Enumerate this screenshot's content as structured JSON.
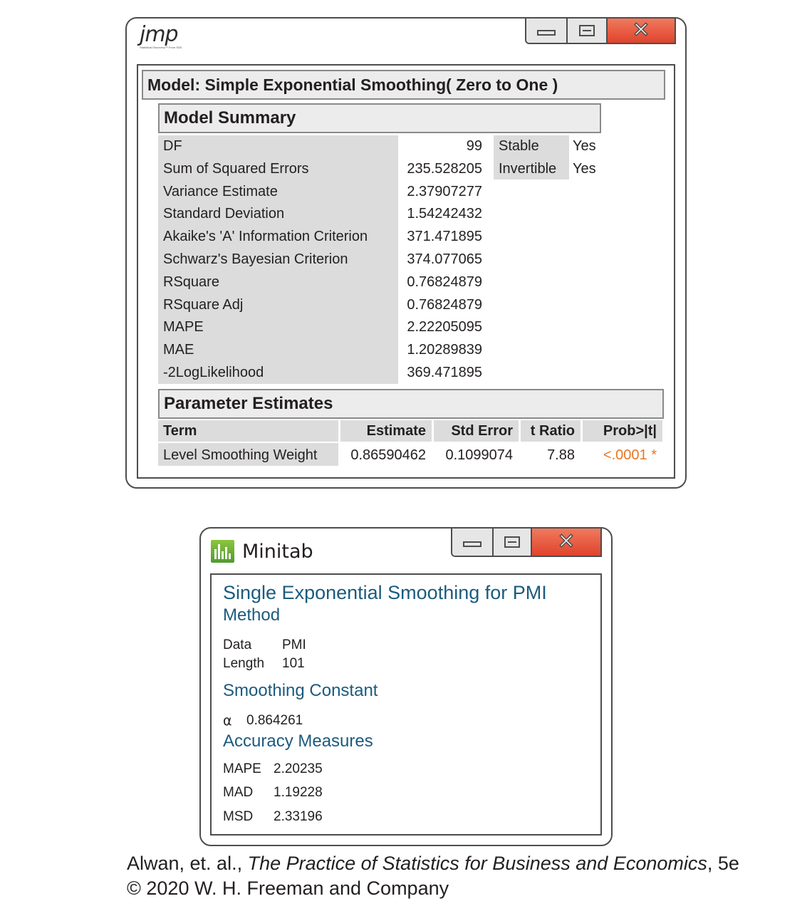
{
  "jmp": {
    "logo_text": "jmp",
    "logo_tagline": "Statistical Discovery™ From SAS",
    "window_title": "Model: Simple Exponential Smoothing( Zero to One )",
    "model_summary": {
      "heading": "Model Summary",
      "rows": [
        {
          "label": "DF",
          "value": "99"
        },
        {
          "label": "Sum of Squared Errors",
          "value": "235.528205"
        },
        {
          "label": "Variance Estimate",
          "value": "2.37907277"
        },
        {
          "label": "Standard Deviation",
          "value": "1.54242432"
        },
        {
          "label": "Akaike's 'A' Information Criterion",
          "value": "371.471895"
        },
        {
          "label": "Schwarz's Bayesian Criterion",
          "value": "374.077065"
        },
        {
          "label": "RSquare",
          "value": "0.76824879"
        },
        {
          "label": "RSquare Adj",
          "value": "0.76824879"
        },
        {
          "label": "MAPE",
          "value": "2.22205095"
        },
        {
          "label": "MAE",
          "value": "1.20289839"
        },
        {
          "label": "-2LogLikelihood",
          "value": "369.471895"
        }
      ],
      "side": [
        {
          "label": "Stable",
          "value": "Yes"
        },
        {
          "label": "Invertible",
          "value": "Yes"
        }
      ]
    },
    "parameter_estimates": {
      "heading": "Parameter Estimates",
      "columns": [
        "Term",
        "Estimate",
        "Std Error",
        "t Ratio",
        "Prob>|t|"
      ],
      "row": {
        "term": "Level Smoothing Weight",
        "estimate": "0.86590462",
        "std_error": "0.1099074",
        "t_ratio": "7.88",
        "prob": "<.0001 *"
      }
    }
  },
  "minitab": {
    "app_name": "Minitab",
    "title": "Single Exponential Smoothing for PMI",
    "method_heading": "Method",
    "method": [
      {
        "label": "Data",
        "value": "PMI"
      },
      {
        "label": "Length",
        "value": "101"
      }
    ],
    "smoothing_heading": "Smoothing Constant",
    "alpha_label": "α",
    "alpha_value": "0.864261",
    "accuracy_heading": "Accuracy Measures",
    "accuracy": [
      {
        "label": "MAPE",
        "value": "2.20235"
      },
      {
        "label": "MAD",
        "value": "1.19228"
      },
      {
        "label": "MSD",
        "value": "2.33196"
      }
    ]
  },
  "footer": {
    "line1_prefix": "Alwan, et. al., ",
    "line1_title": "The Practice of Statistics for Business and Economics",
    "line1_suffix": ", 5e",
    "line2": "© 2020 W. H. Freeman and Company"
  },
  "colors": {
    "accent_orange": "#e87722",
    "minitab_blue": "#1b5b7e",
    "close_red": "#e8563f"
  }
}
